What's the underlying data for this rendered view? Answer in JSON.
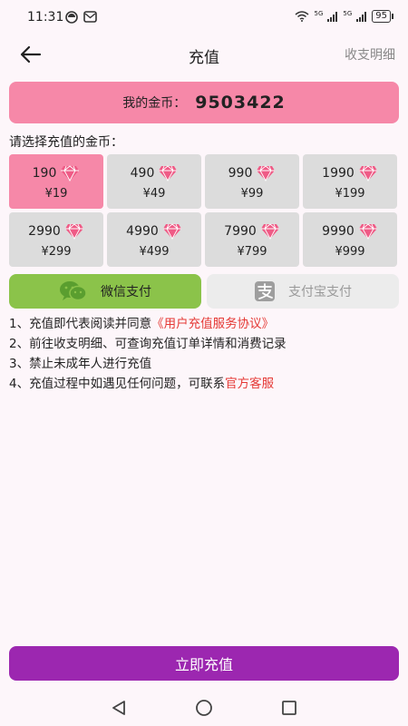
{
  "status_bar": {
    "time": "11:31",
    "signal_label_1": "5G",
    "signal_label_2": "5G",
    "battery": "95"
  },
  "header": {
    "back_icon": "arrow-left-icon",
    "title": "充值",
    "details_link": "收支明细"
  },
  "coins": {
    "label": "我的金币：",
    "value": "9503422"
  },
  "select_prompt": "请选择充值的金币：",
  "packages": [
    {
      "coins": "190",
      "price": "¥19",
      "selected": true
    },
    {
      "coins": "490",
      "price": "¥49",
      "selected": false
    },
    {
      "coins": "990",
      "price": "¥99",
      "selected": false
    },
    {
      "coins": "1990",
      "price": "¥199",
      "selected": false
    },
    {
      "coins": "2990",
      "price": "¥299",
      "selected": false
    },
    {
      "coins": "4990",
      "price": "¥499",
      "selected": false
    },
    {
      "coins": "7990",
      "price": "¥799",
      "selected": false
    },
    {
      "coins": "9990",
      "price": "¥999",
      "selected": false
    }
  ],
  "payment": {
    "wechat_label": "微信支付",
    "alipay_label": "支付宝支付",
    "selected": "wechat"
  },
  "notes": {
    "n1_text": "1、充值即代表阅读并同意",
    "n1_link": "《用户充值服务协议》",
    "n2_text": "2、前往收支明细、可查询充值订单详情和消费记录",
    "n3_text": "3、禁止未成年人进行充值",
    "n4_text": "4、充值过程中如遇见任何问题，可联系",
    "n4_link": "官方客服"
  },
  "recharge_button": "立即充值",
  "colors": {
    "accent_pink": "#f688a8",
    "package_gray": "#dcdcdc",
    "wechat_green": "#8bc34a",
    "primary_purple": "#9c27b0",
    "link_red": "#e53935",
    "diamond": "#ef5b86"
  }
}
